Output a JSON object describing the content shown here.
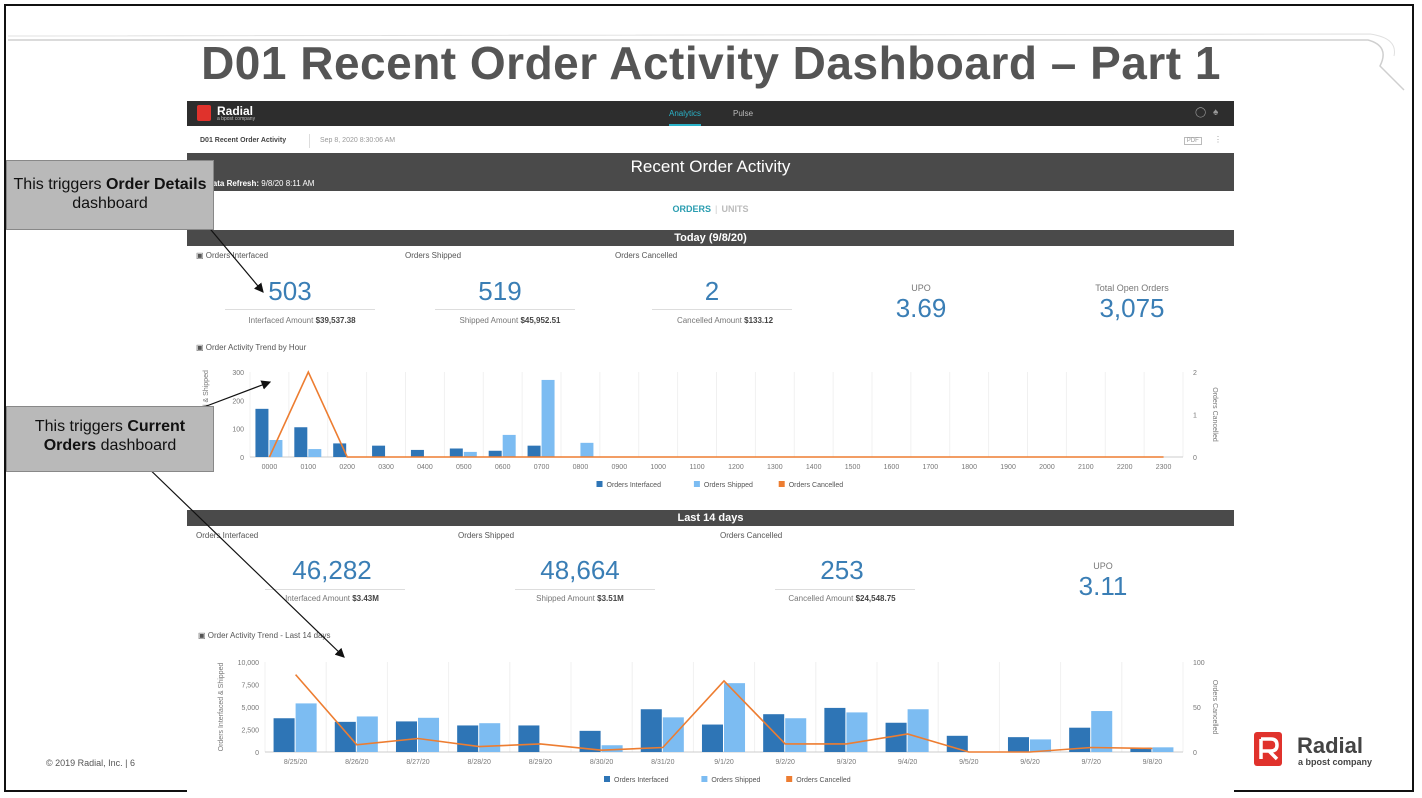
{
  "slide": {
    "title": "D01 Recent Order Activity Dashboard – Part 1",
    "footer": "© 2019 Radial, Inc.  |  6",
    "logo_text": "Radial",
    "logo_sub": "a bpost company"
  },
  "callouts": {
    "order_details": {
      "pre": "This triggers ",
      "bold": "Order Details",
      "post": " dashboard"
    },
    "current_orders": {
      "pre": "This triggers ",
      "bold": "Current Orders",
      "post": " dashboard"
    }
  },
  "app": {
    "brand": "Radial",
    "brand_sub": "a bpost company",
    "tabs": [
      "Analytics",
      "Pulse"
    ],
    "active_tab": "Analytics",
    "dashboard_name": "D01 Recent Order Activity",
    "timestamp": "Sep 8, 2020 8:30:06 AM",
    "export_label": "PDF",
    "header_title": "Recent Order Activity",
    "refresh_label": "Data Refresh:",
    "refresh_value": "9/8/20 8:11 AM",
    "toggle": {
      "orders": "ORDERS",
      "units": "UNITS"
    },
    "colors": {
      "interfaced": "#2e75b6",
      "shipped": "#7cbcf2",
      "cancelled": "#ed7d31",
      "kpi": "#3a7eb5",
      "header": "#4a4a4a",
      "accent": "#2ab2c8"
    }
  },
  "today": {
    "section": "Today (9/8/20)",
    "labels": {
      "interfaced": "Orders Interfaced",
      "shipped": "Orders Shipped",
      "cancelled": "Orders Cancelled"
    },
    "interfaced": {
      "value": "503",
      "sub_label": "Interfaced Amount",
      "sub_value": "$39,537.38"
    },
    "shipped": {
      "value": "519",
      "sub_label": "Shipped Amount",
      "sub_value": "$45,952.51"
    },
    "cancelled": {
      "value": "2",
      "sub_label": "Cancelled Amount",
      "sub_value": "$133.12"
    },
    "upo": {
      "label": "UPO",
      "value": "3.69"
    },
    "open": {
      "label": "Total Open Orders",
      "value": "3,075"
    },
    "chart_title": "Order Activity Trend by Hour"
  },
  "last14": {
    "section": "Last 14 days",
    "labels": {
      "interfaced": "Orders Interfaced",
      "shipped": "Orders Shipped",
      "cancelled": "Orders Cancelled"
    },
    "interfaced": {
      "value": "46,282",
      "sub_label": "Interfaced Amount",
      "sub_value": "$3.43M"
    },
    "shipped": {
      "value": "48,664",
      "sub_label": "Shipped Amount",
      "sub_value": "$3.51M"
    },
    "cancelled": {
      "value": "253",
      "sub_label": "Cancelled Amount",
      "sub_value": "$24,548.75"
    },
    "upo": {
      "label": "UPO",
      "value": "3.11"
    },
    "chart_title": "Order Activity Trend - Last 14 days"
  },
  "chart_data": [
    {
      "type": "bar",
      "title": "Order Activity Trend by Hour",
      "categories": [
        "0000",
        "0100",
        "0200",
        "0300",
        "0400",
        "0500",
        "0600",
        "0700",
        "0800",
        "0900",
        "1000",
        "1100",
        "1200",
        "1300",
        "1400",
        "1500",
        "1600",
        "1700",
        "1800",
        "1900",
        "2000",
        "2100",
        "2200",
        "2300"
      ],
      "series": [
        {
          "name": "Orders Interfaced",
          "kind": "bar",
          "axis": "left",
          "values": [
            170,
            105,
            48,
            40,
            25,
            30,
            22,
            40,
            0,
            0,
            0,
            0,
            0,
            0,
            0,
            0,
            0,
            0,
            0,
            0,
            0,
            0,
            0,
            0
          ]
        },
        {
          "name": "Orders Shipped",
          "kind": "bar",
          "axis": "left",
          "values": [
            60,
            28,
            0,
            0,
            0,
            18,
            78,
            272,
            50,
            0,
            0,
            0,
            0,
            0,
            0,
            0,
            0,
            0,
            0,
            0,
            0,
            0,
            0,
            0
          ]
        },
        {
          "name": "Orders Cancelled",
          "kind": "line",
          "axis": "right",
          "values": [
            0,
            2,
            0,
            0,
            0,
            0,
            0,
            0,
            0,
            0,
            0,
            0,
            0,
            0,
            0,
            0,
            0,
            0,
            0,
            0,
            0,
            0,
            0,
            0
          ]
        }
      ],
      "ylabel": "Orders Interfaced & Shipped",
      "y2label": "Orders Cancelled",
      "ylim": [
        0,
        300
      ],
      "yticks": [
        0,
        100,
        200,
        300
      ],
      "y2lim": [
        0,
        2
      ],
      "y2ticks": [
        0,
        1,
        2
      ],
      "legend": "bottom"
    },
    {
      "type": "bar",
      "title": "Order Activity Trend - Last 14 days",
      "categories": [
        "8/25/20",
        "8/26/20",
        "8/27/20",
        "8/28/20",
        "8/29/20",
        "8/30/20",
        "8/31/20",
        "9/1/20",
        "9/2/20",
        "9/3/20",
        "9/4/20",
        "9/5/20",
        "9/6/20",
        "9/7/20",
        "9/8/20"
      ],
      "series": [
        {
          "name": "Orders Interfaced",
          "kind": "bar",
          "axis": "left",
          "values": [
            3750,
            3350,
            3400,
            2950,
            2950,
            2350,
            4750,
            3050,
            4200,
            4900,
            3250,
            1800,
            1650,
            2700,
            500
          ]
        },
        {
          "name": "Orders Shipped",
          "kind": "bar",
          "axis": "left",
          "values": [
            5400,
            3950,
            3800,
            3200,
            0,
            750,
            3850,
            7650,
            3750,
            4400,
            4750,
            0,
            1400,
            4550,
            520
          ]
        },
        {
          "name": "Orders Cancelled",
          "kind": "line",
          "axis": "right",
          "values": [
            86,
            8,
            15,
            6,
            9,
            2,
            5,
            79,
            9,
            9,
            20,
            0,
            0,
            5,
            4
          ]
        }
      ],
      "ylabel": "Orders Interfaced & Shipped",
      "y2label": "Orders Cancelled",
      "ylim": [
        0,
        10000
      ],
      "yticks": [
        "0",
        "2,500",
        "5,000",
        "7,500",
        "10,000"
      ],
      "y2lim": [
        0,
        100
      ],
      "y2ticks": [
        0,
        50,
        100
      ],
      "legend": "bottom"
    }
  ]
}
